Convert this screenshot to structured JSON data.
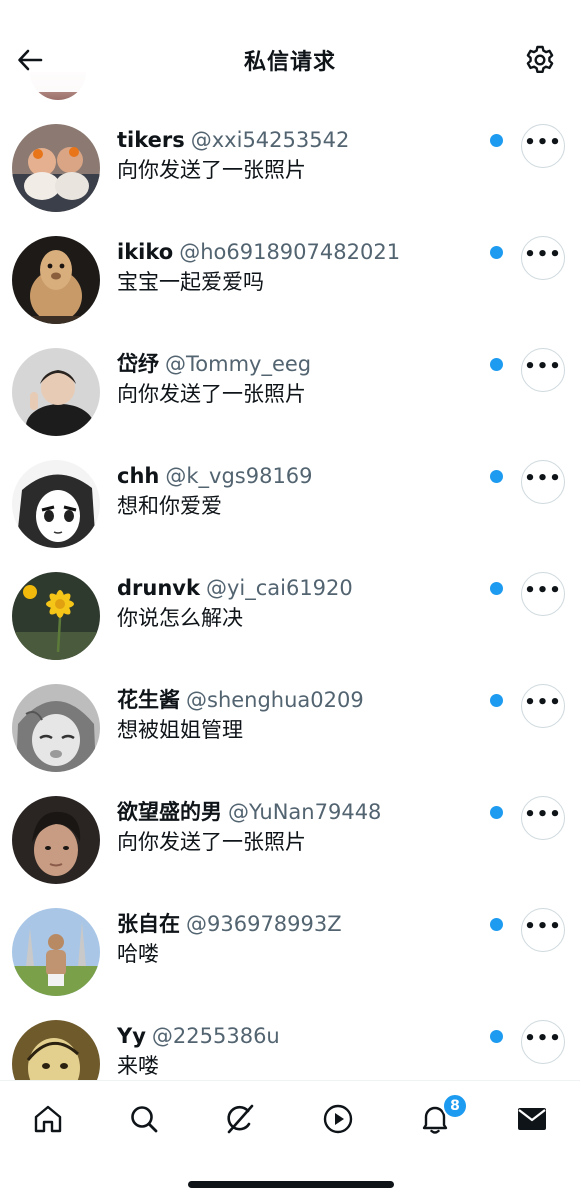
{
  "header": {
    "title": "私信请求"
  },
  "requests": [
    {
      "name": "tikers",
      "handle": "@xxi54253542",
      "message": "向你发送了一张照片"
    },
    {
      "name": "ikiko",
      "handle": "@ho6918907482021",
      "message": "宝宝一起爱爱吗"
    },
    {
      "name": "岱纾",
      "handle": "@Tommy_eeg",
      "message": "向你发送了一张照片"
    },
    {
      "name": "chh",
      "handle": "@k_vgs98169",
      "message": "想和你爱爱"
    },
    {
      "name": "drunvk",
      "handle": "@yi_cai61920",
      "message": "你说怎么解决"
    },
    {
      "name": "花生酱",
      "handle": "@shenghua0209",
      "message": "想被姐姐管理"
    },
    {
      "name": "欲望盛的男",
      "handle": "@YuNan79448",
      "message": "向你发送了一张照片"
    },
    {
      "name": "张自在",
      "handle": "@936978993Z",
      "message": "哈喽"
    },
    {
      "name": "Yy",
      "handle": "@2255386u",
      "message": "来喽"
    }
  ],
  "more_button": {
    "label": "•••"
  },
  "bottom_nav": {
    "notifications_badge": "8"
  },
  "colors": {
    "accent": "#1d9bf0",
    "text_primary": "#0f1419",
    "text_secondary": "#536471",
    "border": "#cfd9de"
  },
  "icons": {
    "back": "arrow-left-icon",
    "settings": "gear-icon",
    "more": "more-horizontal-icon",
    "home": "home-icon",
    "search": "search-icon",
    "grok": "slash-circle-icon",
    "video": "play-circle-icon",
    "notifications": "bell-icon",
    "messages": "envelope-icon"
  }
}
